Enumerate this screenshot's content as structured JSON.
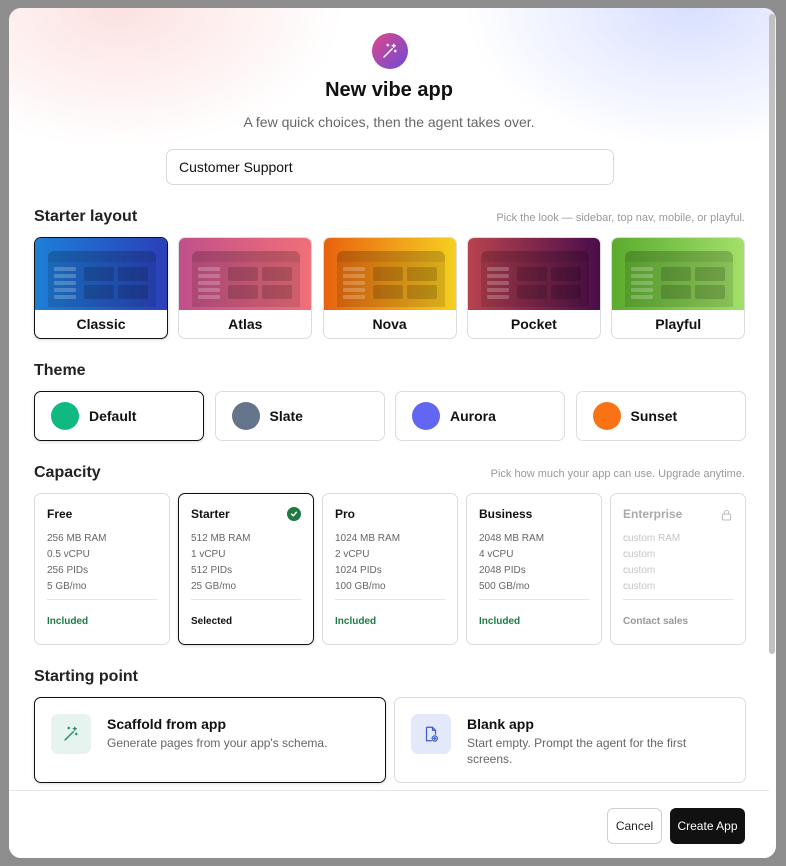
{
  "header": {
    "title": "New vibe app",
    "subtitle": "A few quick choices, then the agent takes over.",
    "icon": "magic-wand-icon"
  },
  "app_name": {
    "value": "Customer Support",
    "placeholder": ""
  },
  "starter_layout": {
    "title": "Starter layout",
    "hint": "Pick the look — sidebar, top nav, mobile, or playful.",
    "selected": "Classic",
    "options": [
      {
        "label": "Classic",
        "gradient": [
          "#1d7fd6",
          "#2b3fb8"
        ]
      },
      {
        "label": "Atlas",
        "gradient": [
          "#c0508a",
          "#f07078"
        ]
      },
      {
        "label": "Nova",
        "gradient": [
          "#e8620f",
          "#f5d020"
        ]
      },
      {
        "label": "Pocket",
        "gradient": [
          "#b8434f",
          "#4a0d4a"
        ]
      },
      {
        "label": "Playful",
        "gradient": [
          "#5aab2e",
          "#a3e06a"
        ]
      }
    ]
  },
  "theme": {
    "title": "Theme",
    "selected": "Default",
    "options": [
      {
        "label": "Default",
        "color": "#10b981"
      },
      {
        "label": "Slate",
        "color": "#64748b"
      },
      {
        "label": "Aurora",
        "color": "#6366f1"
      },
      {
        "label": "Sunset",
        "color": "#f97316"
      }
    ]
  },
  "capacity": {
    "title": "Capacity",
    "hint": "Pick how much your app can use. Upgrade anytime.",
    "selected": "Starter",
    "plans": [
      {
        "name": "Free",
        "specs": [
          "256 MB RAM",
          "0.5 vCPU",
          "256 PIDs",
          "5 GB/mo"
        ],
        "status": "Included"
      },
      {
        "name": "Starter",
        "specs": [
          "512 MB RAM",
          "1 vCPU",
          "512 PIDs",
          "25 GB/mo"
        ],
        "status": "Selected"
      },
      {
        "name": "Pro",
        "specs": [
          "1024 MB RAM",
          "2 vCPU",
          "1024 PIDs",
          "100 GB/mo"
        ],
        "status": "Included"
      },
      {
        "name": "Business",
        "specs": [
          "2048 MB RAM",
          "4 vCPU",
          "2048 PIDs",
          "500 GB/mo"
        ],
        "status": "Included"
      },
      {
        "name": "Enterprise",
        "specs": [
          "custom RAM",
          "custom",
          "custom",
          "custom"
        ],
        "status": "Contact sales",
        "locked": true
      }
    ]
  },
  "starting_point": {
    "title": "Starting point",
    "selected": "Scaffold from app",
    "options": [
      {
        "title": "Scaffold from app",
        "description": "Generate pages from your app's schema.",
        "icon": "magic-wand-icon"
      },
      {
        "title": "Blank app",
        "description": "Start empty. Prompt the agent for the first screens.",
        "icon": "new-file-icon"
      }
    ]
  },
  "footer": {
    "cancel_label": "Cancel",
    "create_label": "Create App"
  }
}
